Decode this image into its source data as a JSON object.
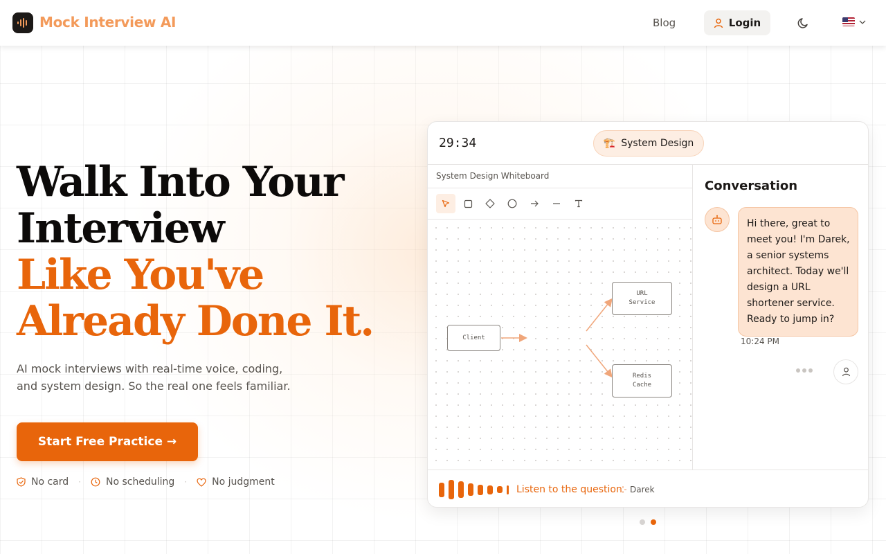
{
  "brand": {
    "name": "Mock Interview AI",
    "accent": "#e8650b"
  },
  "nav": {
    "blog": "Blog",
    "login": "Login",
    "language_flag": "us-flag-icon"
  },
  "hero": {
    "title_line1": "Walk Into Your",
    "title_line2": "Interview",
    "title_line3": "Like You've",
    "title_line4": "Already Done It.",
    "subtitle": "AI mock interviews with real-time voice, coding, and system design. So the real one feels familiar.",
    "cta": "Start Free Practice →",
    "perks": [
      "No card",
      "No scheduling",
      "No judgment"
    ]
  },
  "demo": {
    "timer": "29:34",
    "topic_emoji": "🏗️",
    "topic": "System Design",
    "whiteboard_title": "System Design Whiteboard",
    "tools": [
      "select",
      "rectangle",
      "diamond",
      "ellipse",
      "arrow",
      "line",
      "text"
    ],
    "nodes": {
      "client": "Client",
      "url_service_line1": "URL",
      "url_service_line2": "Service",
      "redis_line1": "Redis",
      "redis_line2": "Cache"
    },
    "conversation_title": "Conversation",
    "message": "Hi there, great to meet you! I'm Darek, a senior systems architect. Today we'll design a URL shortener service. Ready to jump in?",
    "message_time": "10:24 PM",
    "listen_label": "Listen to the question",
    "speaker": "Darek",
    "wave_levels": [
      0.75,
      1.0,
      0.85,
      0.65,
      0.55,
      0.45,
      0.35,
      0.45
    ]
  },
  "carousel": {
    "count": 2,
    "active_index": 1
  }
}
